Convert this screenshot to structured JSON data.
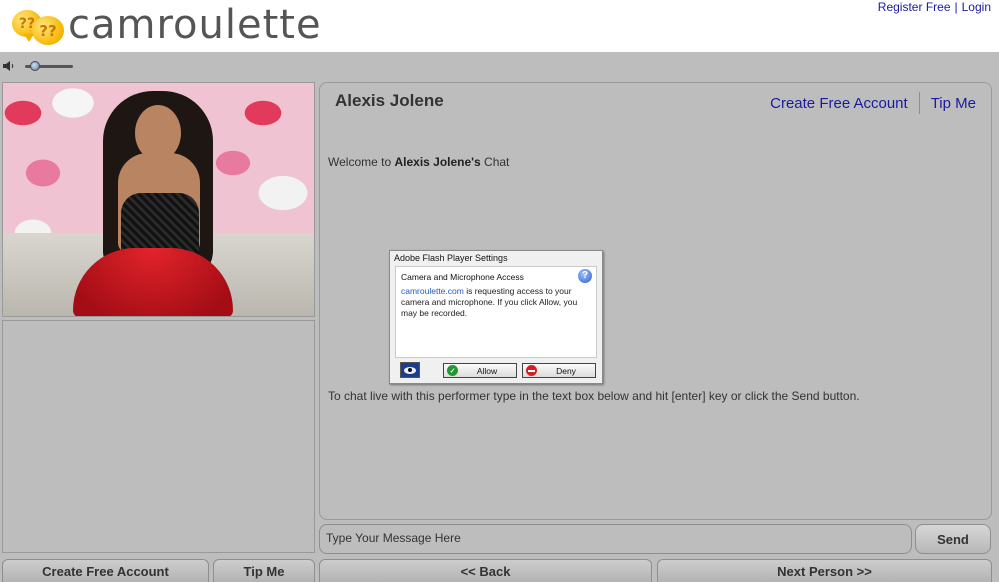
{
  "header": {
    "logo_text": "camroulette",
    "logo_glyph": "??",
    "register_link": "Register Free",
    "separator": "|",
    "login_link": "Login"
  },
  "player": {
    "volume_level": 0.2
  },
  "chat": {
    "performer_name": "Alexis Jolene",
    "create_account_link": "Create Free Account",
    "tip_link": "Tip Me",
    "welcome_prefix": "Welcome to ",
    "welcome_name": "Alexis Jolene's",
    "welcome_suffix": " Chat",
    "instructions": "To chat live with this performer type in the text box below and hit [enter] key or click the Send button.",
    "message_placeholder": "Type Your Message Here",
    "send_label": "Send"
  },
  "flash_dialog": {
    "title": "Adobe Flash Player Settings",
    "heading": "Camera and Microphone Access",
    "help_glyph": "?",
    "site": "camroulette.com",
    "message": " is requesting access to your camera and microphone. If you click Allow, you may be recorded.",
    "allow_label": "Allow",
    "allow_glyph": "✓",
    "deny_label": "Deny"
  },
  "bottom_bar": {
    "create_account": "Create Free Account",
    "tip_me": "Tip Me",
    "back": "<< Back",
    "next": "Next Person >>"
  },
  "colors": {
    "panel_bg": "#bdbdbd",
    "link": "#1a1aa0",
    "flash_link": "#2358c2"
  }
}
